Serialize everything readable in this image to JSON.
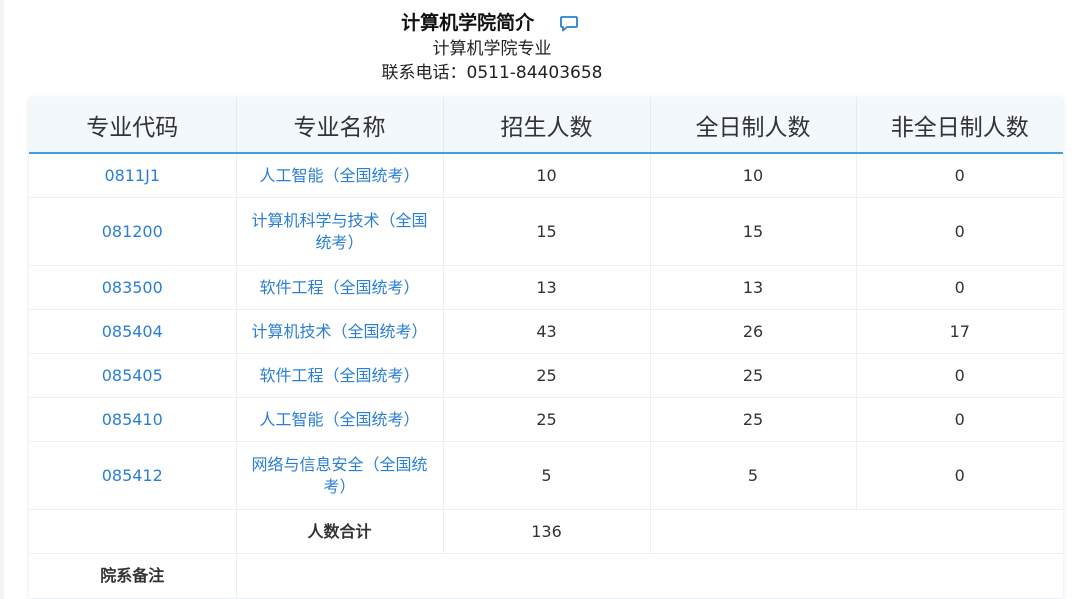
{
  "header": {
    "title": "计算机学院简介",
    "subtitle": "计算机学院专业",
    "phone": "联系电话：0511-84403658"
  },
  "colors": {
    "link": "#2a7fd4",
    "header_bg": "#f3f8fd",
    "accent_line": "#3ba0e6"
  },
  "icons": {
    "comment": "comment-icon"
  },
  "table": {
    "headers": [
      "专业代码",
      "专业名称",
      "招生人数",
      "全日制人数",
      "非全日制人数"
    ],
    "rows": [
      {
        "code": "0811J1",
        "name": "人工智能（全国统考）",
        "total": "10",
        "fulltime": "10",
        "parttime": "0"
      },
      {
        "code": "081200",
        "name": "计算机科学与技术（全国统考）",
        "total": "15",
        "fulltime": "15",
        "parttime": "0"
      },
      {
        "code": "083500",
        "name": "软件工程（全国统考）",
        "total": "13",
        "fulltime": "13",
        "parttime": "0"
      },
      {
        "code": "085404",
        "name": "计算机技术（全国统考）",
        "total": "43",
        "fulltime": "26",
        "parttime": "17"
      },
      {
        "code": "085405",
        "name": "软件工程（全国统考）",
        "total": "25",
        "fulltime": "25",
        "parttime": "0"
      },
      {
        "code": "085410",
        "name": "人工智能（全国统考）",
        "total": "25",
        "fulltime": "25",
        "parttime": "0"
      },
      {
        "code": "085412",
        "name": "网络与信息安全（全国统考）",
        "total": "5",
        "fulltime": "5",
        "parttime": "0"
      }
    ],
    "total_label": "人数合计",
    "total_value": "136",
    "note_label": "院系备注",
    "note_value": ""
  }
}
